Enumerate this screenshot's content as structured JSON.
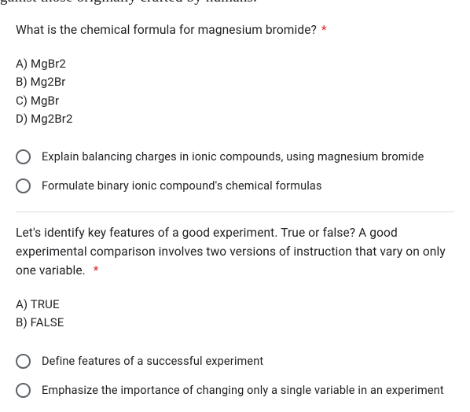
{
  "page": {
    "cutoff_top": "gainst those originally crafted by humans."
  },
  "q1": {
    "text": "What is the chemical formula for magnesium bromide?",
    "required": "*",
    "answers": {
      "a": "A) MgBr2",
      "b": "B) Mg2Br",
      "c": "C) MgBr",
      "d": "D) Mg2Br2"
    },
    "options": {
      "opt1": "Explain balancing charges in ionic compounds, using magnesium bromide",
      "opt2": "Formulate binary ionic compound's chemical formulas"
    }
  },
  "q2": {
    "text": "Let's identify key features of a good experiment. True or false? A good experimental comparison involves two versions of instruction that vary on only one variable.",
    "required": "*",
    "answers": {
      "a": "A) TRUE",
      "b": "B) FALSE"
    },
    "options": {
      "opt1": "Define features of a successful experiment",
      "opt2": "Emphasize the importance of changing only a single variable in an experiment"
    }
  }
}
